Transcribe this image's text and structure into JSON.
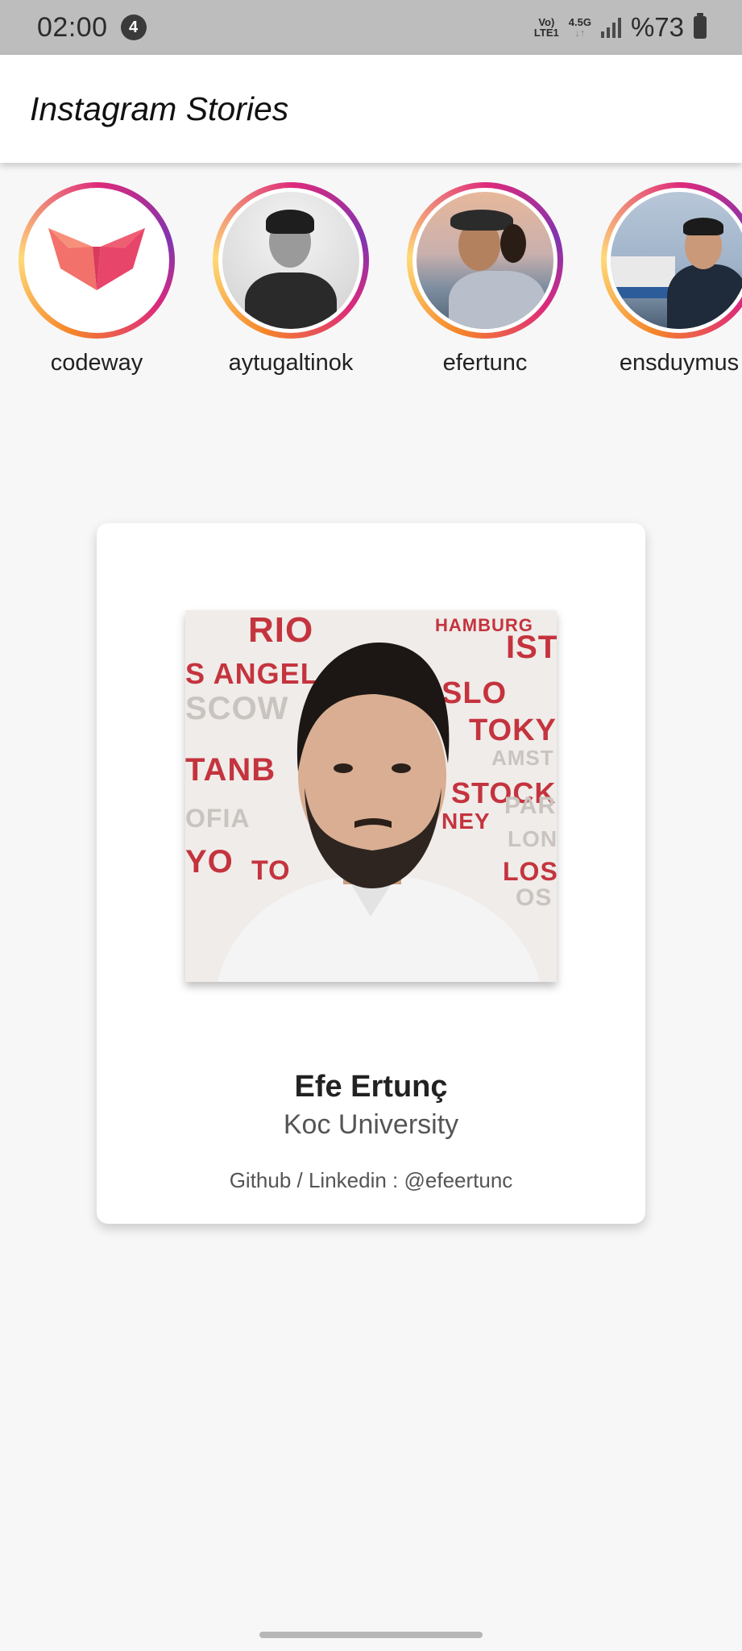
{
  "status_bar": {
    "time": "02:00",
    "notification_count": "4",
    "network_top": "Vo)",
    "network_bottom": "LTE1",
    "network_type": "4.5G",
    "battery": "%73"
  },
  "app_bar": {
    "title": "Instagram Stories"
  },
  "stories": [
    {
      "name": "codeway"
    },
    {
      "name": "aytugaltinok"
    },
    {
      "name": "efertunc"
    },
    {
      "name": "ensduymus"
    }
  ],
  "profile": {
    "name": "Efe Ertunç",
    "school": "Koc University",
    "social": "Github / Linkedin : @efeertunc",
    "photo_words": [
      "RIO",
      "HAMBURG",
      "IST",
      "S ANGEL",
      "SCOW",
      "SLO",
      "TOKY",
      "TANB",
      "STOCK",
      "OFIA",
      "NEY",
      "YO",
      "TO",
      "LOS",
      "LON",
      "OS",
      "PAR",
      "AMST"
    ]
  },
  "colors": {
    "status_bar_bg": "#bdbdbd",
    "app_bar_bg": "#ffffff",
    "page_bg": "#f7f7f7",
    "story_ring_start": "#f58529",
    "story_ring_mid": "#dd2a7b",
    "story_ring_end": "#8134af",
    "codeway_logo": "#ee5a6f"
  }
}
